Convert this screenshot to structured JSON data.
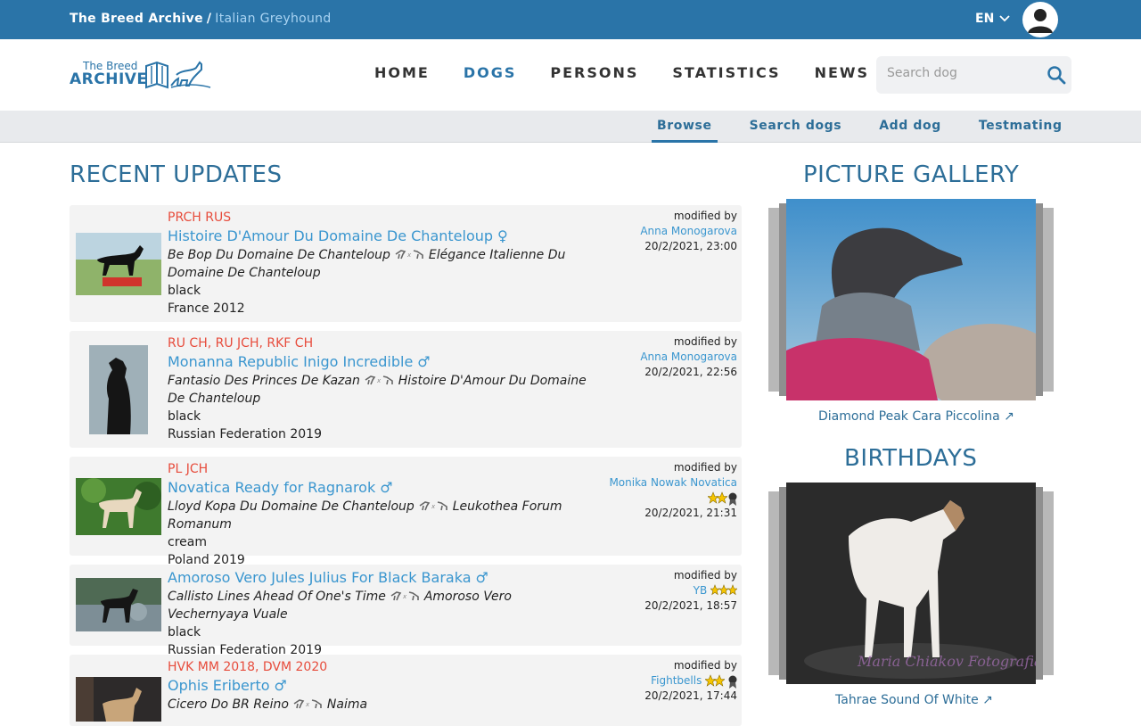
{
  "topbar": {
    "site": "The Breed Archive",
    "separator": "/",
    "breed": "Italian Greyhound",
    "lang": "EN"
  },
  "logo": {
    "line1": "The Breed",
    "line2": "ARCHIVE"
  },
  "nav": {
    "home": "HOME",
    "dogs": "DOGS",
    "persons": "PERSONS",
    "statistics": "STATISTICS",
    "news": "NEWS"
  },
  "search": {
    "placeholder": "Search dog"
  },
  "subnav": {
    "browse": "Browse",
    "search_dogs": "Search dogs",
    "add_dog": "Add dog",
    "testmating": "Testmating"
  },
  "recent": {
    "title": "RECENT UPDATES",
    "modified_label": "modified by",
    "items": [
      {
        "titles": "PRCH RUS",
        "name": "Histoire D'Amour Du Domaine De Chanteloup",
        "sex": "♀",
        "sire": "Be Bop Du Domaine De Chanteloup",
        "dam": "Elégance Italienne Du Domaine De Chanteloup",
        "color": "black",
        "origin": "France 2012",
        "modified_by": "Anna Monogarova",
        "date": "20/2/2021, 23:00"
      },
      {
        "titles": "RU CH, RU JCH, RKF CH",
        "name": "Monanna Republic Inigo Incredible",
        "sex": "♂",
        "sire": "Fantasio Des Princes De Kazan",
        "dam": "Histoire D'Amour Du Domaine De Chanteloup",
        "color": "black",
        "origin": "Russian Federation 2019",
        "modified_by": "Anna Monogarova",
        "date": "20/2/2021, 22:56"
      },
      {
        "titles": "PL JCH",
        "name": "Novatica Ready for Ragnarok",
        "sex": "♂",
        "sire": "Lloyd Kopa Du Domaine De Chanteloup",
        "dam": "Leukothea Forum Romanum",
        "color": "cream",
        "origin": "Poland 2019",
        "modified_by": "Monika Nowak Novatica",
        "date": "20/2/2021, 21:31"
      },
      {
        "titles": "",
        "name": "Amoroso Vero Jules Julius For Black Baraka",
        "sex": "♂",
        "sire": "Callisto Lines Ahead Of One's Time",
        "dam": "Amoroso Vero Vechernyaya Vuale",
        "color": "black",
        "origin": "Russian Federation 2019",
        "modified_by": "YB",
        "date": "20/2/2021, 18:57"
      },
      {
        "titles": "HVK MM 2018, DVM 2020",
        "name": "Ophis Eriberto",
        "sex": "♂",
        "sire": "Cicero Do BR Reino",
        "dam": "Naima",
        "color": "",
        "origin": "",
        "modified_by": "Fightbells",
        "date": "20/2/2021, 17:44"
      }
    ]
  },
  "gallery": {
    "title": "PICTURE GALLERY",
    "caption": "Diamond Peak Cara Piccolina ↗"
  },
  "birthdays": {
    "title": "BIRTHDAYS",
    "caption": "Tahrae Sound Of White ↗",
    "watermark": "Maria Chiakov Fotografia"
  },
  "colors": {
    "brand": "#2a74a8",
    "link": "#3a96cf",
    "titles": "#e74c3c",
    "card_bg": "#f3f3f3"
  }
}
